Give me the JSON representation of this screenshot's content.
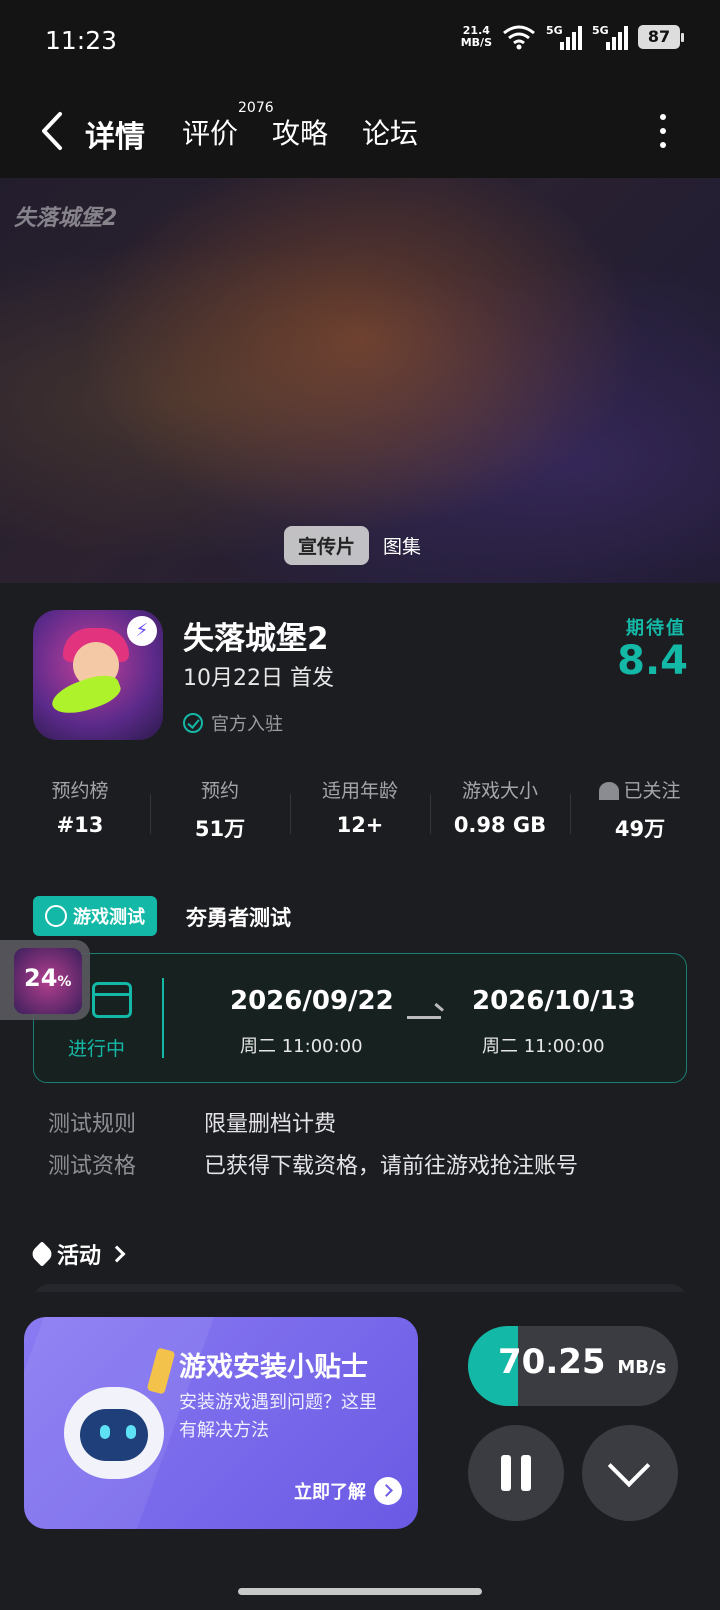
{
  "status_bar": {
    "time": "11:23",
    "net_speed_value": "21.4",
    "net_speed_unit": "MB/S",
    "sim1": "5G",
    "sim2": "5G",
    "battery": "87"
  },
  "nav": {
    "tabs": [
      {
        "label": "详情"
      },
      {
        "label": "评价",
        "badge": "2076"
      },
      {
        "label": "攻略"
      },
      {
        "label": "论坛"
      }
    ]
  },
  "banner": {
    "logo_text": "失落城堡2",
    "tabs": [
      "宣传片",
      "图集"
    ]
  },
  "game": {
    "title": "失落城堡2",
    "release": "10月22日 首发",
    "official": "官方入驻",
    "expect_label": "期待值",
    "expect_value": "8.4"
  },
  "stats": [
    {
      "key": "预约榜",
      "value": "#13"
    },
    {
      "key": "预约",
      "value": "51万"
    },
    {
      "key": "适用年龄",
      "value": "12+"
    },
    {
      "key": "游戏大小",
      "value": "0.98 GB"
    },
    {
      "key": "已关注",
      "value": "49万"
    }
  ],
  "test": {
    "tag": "游戏测试",
    "name": "夯勇者测试",
    "status": "进行中",
    "start_date": "2026/09/22",
    "start_time": "周二  11:00:00",
    "end_date": "2026/10/13",
    "end_time": "周二  11:00:00",
    "rules": [
      {
        "key": "测试规则",
        "value": "限量删档计费"
      },
      {
        "key": "测试资格",
        "value": "已获得下载资格，请前往游戏抢注账号"
      }
    ]
  },
  "floating_progress": {
    "percent": "24",
    "unit": "%"
  },
  "activity": {
    "label": "活动"
  },
  "tip": {
    "title": "游戏安装小贴士",
    "desc": "安装游戏遇到问题？这里有解决方法",
    "link": "立即了解"
  },
  "download": {
    "speed": "70.25",
    "unit": "MB/s",
    "progress_fraction": 0.24
  },
  "colors": {
    "accent": "#14b8a6",
    "background": "#1c1d21",
    "tip_card": "#7a6bee"
  }
}
